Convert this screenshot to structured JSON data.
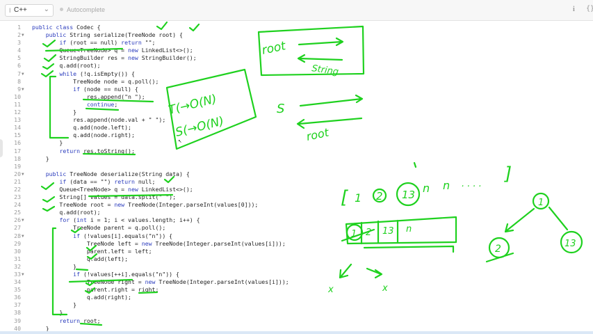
{
  "toolbar": {
    "language": "C++",
    "autocomplete_label": "Autocomplete",
    "info_glyph": "i",
    "format_glyph": "{}"
  },
  "editor": {
    "line_numbers": [
      "1",
      "2",
      "3",
      "4",
      "5",
      "6",
      "7",
      "8",
      "9",
      "10",
      "11",
      "12",
      "13",
      "14",
      "15",
      "16",
      "17",
      "18",
      "19",
      "20",
      "21",
      "22",
      "23",
      "24",
      "25",
      "26",
      "27",
      "28",
      "29",
      "30",
      "31",
      "32",
      "33",
      "34",
      "35",
      "36",
      "37",
      "38",
      "39",
      "40"
    ],
    "lines": [
      "public class Codec {",
      "    public String serialize(TreeNode root) {",
      "        if (root == null) return \"\";",
      "        Queue<TreeNode> q = new LinkedList<>();",
      "        StringBuilder res = new StringBuilder();",
      "        q.add(root);",
      "        while (!q.isEmpty()) {",
      "            TreeNode node = q.poll();",
      "            if (node == null) {",
      "                res.append(\"n \");",
      "                continue;",
      "            }",
      "            res.append(node.val + \" \");",
      "            q.add(node.left);",
      "            q.add(node.right);",
      "        }",
      "        return res.toString();",
      "    }",
      "",
      "    public TreeNode deserialize(String data) {",
      "        if (data == \"\") return null;",
      "        Queue<TreeNode> q = new LinkedList<>();",
      "        String[] values = data.split(\" \");",
      "        TreeNode root = new TreeNode(Integer.parseInt(values[0]));",
      "        q.add(root);",
      "        for (int i = 1; i < values.length; i++) {",
      "            TreeNode parent = q.poll();",
      "            if (!values[i].equals(\"n\")) {",
      "                TreeNode left = new TreeNode(Integer.parseInt(values[i]));",
      "                parent.left = left;",
      "                q.add(left);",
      "            }",
      "            if (!values[++i].equals(\"n\")) {",
      "                TreeNode right = new TreeNode(Integer.parseInt(values[i]));",
      "                parent.right = right;",
      "                q.add(right);",
      "            }",
      "        }",
      "        return root;",
      "    }"
    ],
    "fold_lines": [
      2,
      7,
      9,
      20,
      26,
      28,
      33
    ]
  },
  "annotations": {
    "root_label": "root",
    "string_label": "String",
    "complexity_time": "T(→O(N)",
    "complexity_space": "S(→O(N)",
    "s_label": "S",
    "root_label_2": "root",
    "sequence_open": "[",
    "seq_1": "1",
    "seq_2": "2",
    "seq_13": "13",
    "seq_n1": "n",
    "seq_n2": "n",
    "seq_dots": ". . . .",
    "sequence_close": "]",
    "queue_1": "1",
    "queue_2": "2",
    "queue_13": "13",
    "queue_n": "n",
    "tree_root": "1",
    "tree_left": "2",
    "tree_right": "13",
    "null_x1": "x",
    "null_x2": "x",
    "ink_color": "#1ed11e"
  }
}
